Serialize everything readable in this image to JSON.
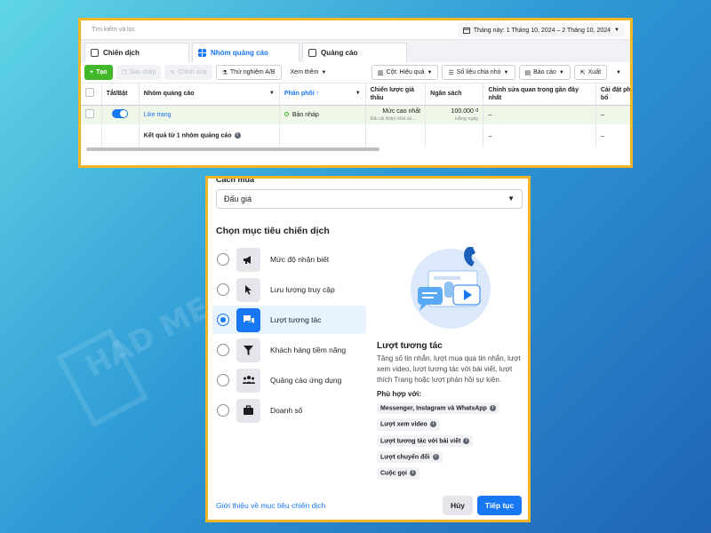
{
  "watermark": "HAD ME",
  "top": {
    "search_placeholder": "Tìm kiếm và lọc",
    "date_range": "Tháng này: 1 Tháng 10, 2024 – 2 Tháng 10, 2024",
    "tabs": [
      {
        "label": "Chiến dịch"
      },
      {
        "label": "Nhóm quảng cáo"
      },
      {
        "label": "Quảng cáo"
      }
    ],
    "toolbar": {
      "create": "Tạo",
      "copy": "Sao chép",
      "edit": "Chỉnh sửa",
      "ab_test": "Thử nghiệm A/B",
      "more": "Xem thêm",
      "columns": "Cột: Hiệu quả",
      "breakdown": "Số liệu chia nhỏ",
      "reports": "Báo cáo",
      "export": "Xuất"
    },
    "table": {
      "headers": [
        "Tắt/Bật",
        "Nhóm quảng cáo",
        "Phân phối ↑",
        "Chiến lược giá thầu",
        "Ngân sách",
        "Chỉnh sửa quan trọng gần đây nhất",
        "Cài đặt phân bổ"
      ],
      "row": {
        "name": "Like trang",
        "delivery": "Bản nháp",
        "bid": "Mức cao nhất",
        "bid_sub": "Đã cải thiện khả sú...",
        "budget": "100.000 ₫",
        "budget_sub": "Hằng ngày",
        "recent_edit": "–",
        "attribution": "–"
      },
      "summary": {
        "label": "Kết quả từ 1 nhóm quảng cáo",
        "recent_edit": "–",
        "attribution": "–"
      }
    }
  },
  "dialog": {
    "buy_type_label": "Cách mua",
    "buy_type_value": "Đấu giá",
    "objective_heading": "Chọn mục tiêu chiến dịch",
    "objectives": [
      {
        "label": "Mức độ nhận biết",
        "icon": "megaphone-icon"
      },
      {
        "label": "Lưu lượng truy cập",
        "icon": "cursor-icon"
      },
      {
        "label": "Lượt tương tác",
        "icon": "chat-bubbles-icon"
      },
      {
        "label": "Khách hàng tiềm năng",
        "icon": "funnel-icon"
      },
      {
        "label": "Quảng cáo ứng dụng",
        "icon": "people-icon"
      },
      {
        "label": "Doanh số",
        "icon": "briefcase-icon"
      }
    ],
    "selected_index": 2,
    "detail": {
      "title": "Lượt tương tác",
      "description": "Tăng số tin nhắn, lượt mua qua tin nhắn, lượt xem video, lượt tương tác với bài viết, lượt thích Trang hoặc lượt phản hồi sự kiện.",
      "fit_label": "Phù hợp với:",
      "chips": [
        "Messenger, Instagram và WhatsApp",
        "Lượt xem video",
        "Lượt tương tác với bài viết",
        "Lượt chuyển đổi",
        "Cuộc gọi"
      ]
    },
    "footer": {
      "link": "Giới thiệu về mục tiêu chiến dịch",
      "cancel": "Hủy",
      "next": "Tiếp tục"
    }
  },
  "colors": {
    "accent": "#1877f2",
    "highlight_border": "#f2b527",
    "create_green": "#42b72a"
  }
}
